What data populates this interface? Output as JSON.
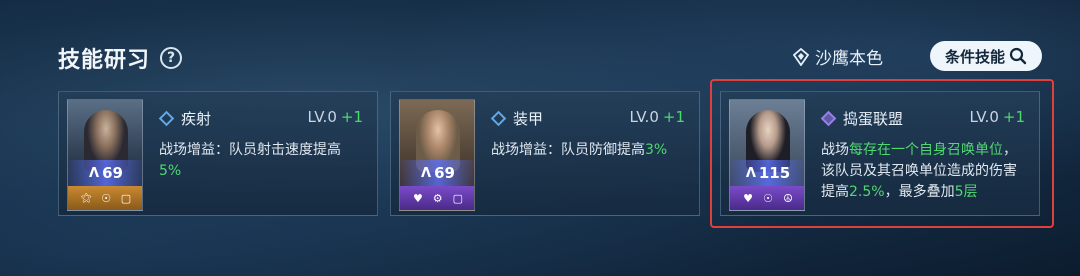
{
  "header": {
    "title": "技能研习",
    "help_glyph": "?"
  },
  "skin": {
    "label": "沙鹰本色",
    "icon": "diamond-badge-icon"
  },
  "filter_button": {
    "label": "条件技能",
    "icon": "search-icon"
  },
  "cards": [
    {
      "level": "69",
      "rarity": "gold",
      "skill_name": "疾射",
      "lv_label": "LV.0",
      "lv_plus": "+1",
      "desc_prefix": "战场增益：队员射击速度提高",
      "desc_highlight": "5%"
    },
    {
      "level": "69",
      "rarity": "purple",
      "skill_name": "装甲",
      "lv_label": "LV.0",
      "lv_plus": "+1",
      "desc_prefix": "战场增益：队员防御提高",
      "desc_highlight": "3%"
    },
    {
      "level": "115",
      "rarity": "purple",
      "skill_name": "捣蛋联盟",
      "lv_label": "LV.0",
      "lv_plus": "+1",
      "desc_parts": [
        "战场",
        "每存在一个自身召唤单位",
        "，该队员及其召唤单位造成的伤害提高",
        "2.5%",
        "，最多叠加",
        "5层"
      ]
    }
  ],
  "colors": {
    "accent_green": "#4fd870",
    "highlight_border": "#e0403c",
    "skill_icon_blue": "#5fa8ea"
  }
}
